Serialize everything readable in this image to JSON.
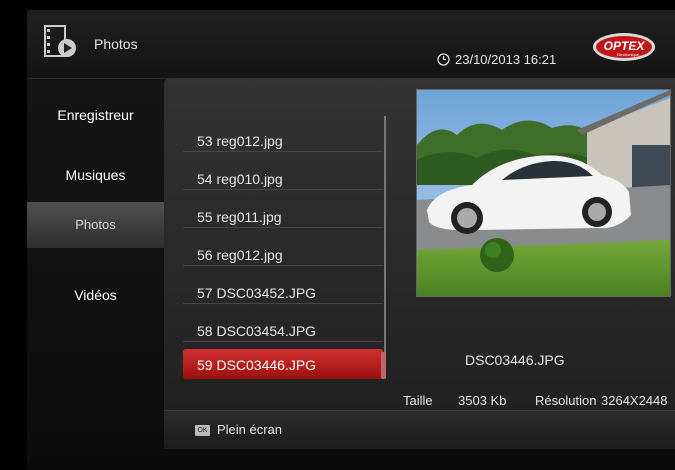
{
  "header": {
    "title": "Photos",
    "datetime": "23/10/2013 16:21"
  },
  "logo": {
    "brand": "OPTEX",
    "tagline": "Electronique"
  },
  "sidebar": {
    "items": [
      {
        "label": "Enregistreur"
      },
      {
        "label": "Musiques"
      },
      {
        "label": "Photos"
      },
      {
        "label": "Vidéos"
      }
    ],
    "selected_index": 2
  },
  "files": [
    {
      "label": "53 reg012.jpg"
    },
    {
      "label": "54 reg010.jpg"
    },
    {
      "label": "55 reg011.jpg"
    },
    {
      "label": "56 reg012.jpg"
    },
    {
      "label": "57 DSC03452.JPG"
    },
    {
      "label": "58 DSC03454.JPG"
    },
    {
      "label": "59 DSC03446.JPG"
    }
  ],
  "selected_file_index": 6,
  "preview": {
    "filename": "DSC03446.JPG",
    "size_label": "Taille",
    "size_value": "3503 Kb",
    "resolution_label": "Résolution",
    "resolution_value": "3264X2448"
  },
  "footer": {
    "key_label": "OK",
    "action_label": "Plein écran"
  },
  "colors": {
    "accent": "#c42020",
    "background": "#000000",
    "panel": "#2b2b2b"
  }
}
